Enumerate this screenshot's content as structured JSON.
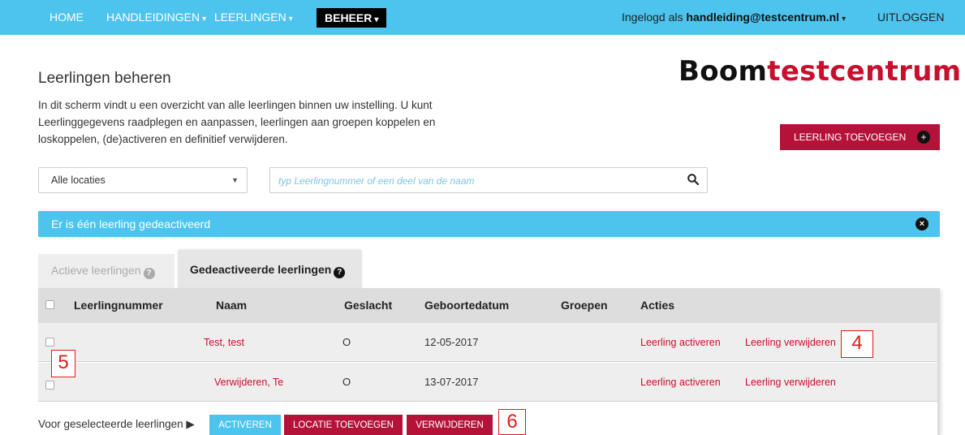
{
  "nav": {
    "home": "HOME",
    "handleidingen": "HANDLEIDINGEN",
    "leerlingen": "LEERLINGEN",
    "beheer": "BEHEER",
    "login_prefix": "Ingelogd als",
    "login_user": "handleiding@testcentrum.nl",
    "logout": "UITLOGGEN",
    "caret": "▾"
  },
  "brand": {
    "part1": "Boom",
    "part2": "testcentrum"
  },
  "page": {
    "title": "Leerlingen beheren",
    "intro": "In dit scherm vindt u een overzicht van alle leerlingen binnen uw instelling. U kunt Leerlinggegevens raadplegen en aanpassen, leerlingen aan groepen koppelen en loskoppelen, (de)activeren en definitief verwijderen."
  },
  "add_button": {
    "label": "LEERLING TOEVOEGEN",
    "icon": "+"
  },
  "filters": {
    "location": "Alle locaties",
    "search_placeholder": "typ Leerlingnummer of een deel van de naam"
  },
  "alert": {
    "text": "Er is één leerling gedeactiveerd",
    "close": "×"
  },
  "tabs": [
    {
      "label": "Actieve leerlingen",
      "icon": "?"
    },
    {
      "label": "Gedeactiveerde leerlingen",
      "icon": "?"
    }
  ],
  "table": {
    "headers": [
      "Leerlingnummer",
      "Naam",
      "Geslacht",
      "Geboortedatum",
      "Groepen",
      "Acties"
    ],
    "rows": [
      {
        "nummer": "",
        "naam": "Test, test",
        "geslacht": "O",
        "geboortedatum": "12-05-2017",
        "groepen": "",
        "activeren": "Leerling activeren",
        "verwijderen": "Leerling verwijderen"
      },
      {
        "nummer": "",
        "naam": "Verwijderen, Te",
        "geslacht": "O",
        "geboortedatum": "13-07-2017",
        "groepen": "",
        "activeren": "Leerling activeren",
        "verwijderen": "Leerling verwijderen"
      }
    ]
  },
  "footer": {
    "label": "Voor geselecteerde leerlingen ▶",
    "activeren": "ACTIVEREN",
    "locatie": "LOCATIE TOEVOEGEN",
    "verwijderen": "VERWIJDEREN"
  },
  "markers": {
    "m4": "4",
    "m5": "5",
    "m6": "6"
  },
  "colors": {
    "nav_bg": "#4cc4ee",
    "brand_red": "#c8102e",
    "button_red": "#b5123a"
  }
}
